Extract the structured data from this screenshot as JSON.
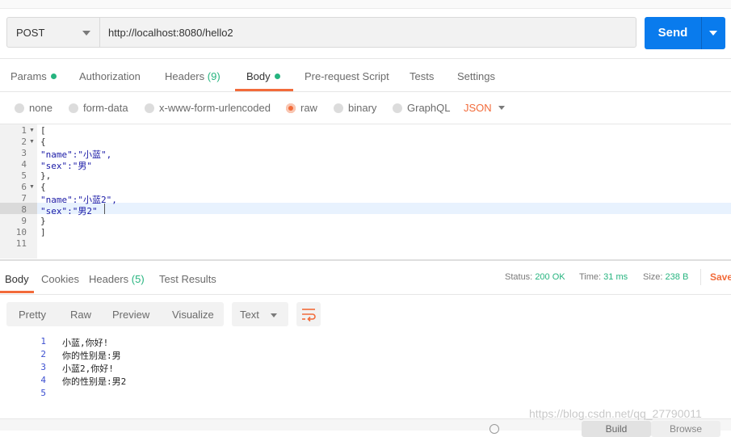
{
  "request": {
    "method": "POST",
    "url": "http://localhost:8080/hello2",
    "send_label": "Send"
  },
  "request_tabs": [
    {
      "label": "Params",
      "dot": true
    },
    {
      "label": "Authorization"
    },
    {
      "label": "Headers",
      "count": "(9)"
    },
    {
      "label": "Body",
      "dot": true,
      "active": true
    },
    {
      "label": "Pre-request Script"
    },
    {
      "label": "Tests"
    },
    {
      "label": "Settings"
    }
  ],
  "body_types": [
    {
      "label": "none"
    },
    {
      "label": "form-data"
    },
    {
      "label": "x-www-form-urlencoded"
    },
    {
      "label": "raw",
      "selected": true
    },
    {
      "label": "binary"
    },
    {
      "label": "GraphQL"
    }
  ],
  "raw_format": "JSON",
  "editor": {
    "line_numbers": [
      "1",
      "2",
      "3",
      "4",
      "5",
      "6",
      "7",
      "8",
      "9",
      "10",
      "11"
    ],
    "lines": [
      "[",
      "{",
      "\"name\":\"小蓝\",",
      "\"sex\":\"男\"",
      "},",
      "{",
      "\"name\":\"小蓝2\",",
      "\"sex\":\"男2\"",
      "}",
      "]",
      ""
    ],
    "current_line": 8
  },
  "response_tabs": [
    {
      "label": "Body",
      "active": true
    },
    {
      "label": "Cookies"
    },
    {
      "label": "Headers",
      "count": "(5)"
    },
    {
      "label": "Test Results"
    }
  ],
  "status": {
    "status_label": "Status:",
    "status_value": "200 OK",
    "time_label": "Time:",
    "time_value": "31 ms",
    "size_label": "Size:",
    "size_value": "238 B",
    "save_label": "Save"
  },
  "view_modes": [
    "Pretty",
    "Raw",
    "Preview",
    "Visualize"
  ],
  "text_format": "Text",
  "response_body": {
    "line_numbers": [
      "1",
      "2",
      "3",
      "4",
      "5"
    ],
    "lines": [
      "小蓝,你好!",
      "你的性别是:男",
      "小蓝2,你好!",
      "你的性别是:男2",
      ""
    ]
  },
  "watermark": "https://blog.csdn.net/qq_27790011",
  "bottom_bar": {
    "build_label": "Build",
    "browse_label": "Browse"
  },
  "colors": {
    "accent": "#f26b3a",
    "send": "#097bed",
    "success": "#26b47f"
  }
}
